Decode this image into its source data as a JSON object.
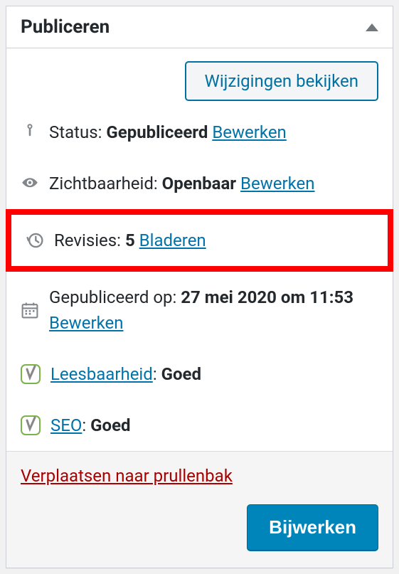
{
  "panel": {
    "title": "Publiceren",
    "preview_button": "Wijzigingen bekijken"
  },
  "status": {
    "label": "Status:",
    "value": "Gepubliceerd",
    "edit": "Bewerken"
  },
  "visibility": {
    "label": "Zichtbaarheid:",
    "value": "Openbaar",
    "edit": "Bewerken"
  },
  "revisions": {
    "label": "Revisies:",
    "count": "5",
    "browse": "Bladeren"
  },
  "published": {
    "label": "Gepubliceerd op:",
    "value": "27 mei 2020 om 11:53",
    "edit": "Bewerken"
  },
  "yoast": {
    "readability": {
      "label": "Leesbaarheid",
      "value": "Goed"
    },
    "seo": {
      "label": "SEO",
      "value": "Goed"
    }
  },
  "actions": {
    "trash": "Verplaatsen naar prullenbak",
    "update": "Bijwerken"
  }
}
